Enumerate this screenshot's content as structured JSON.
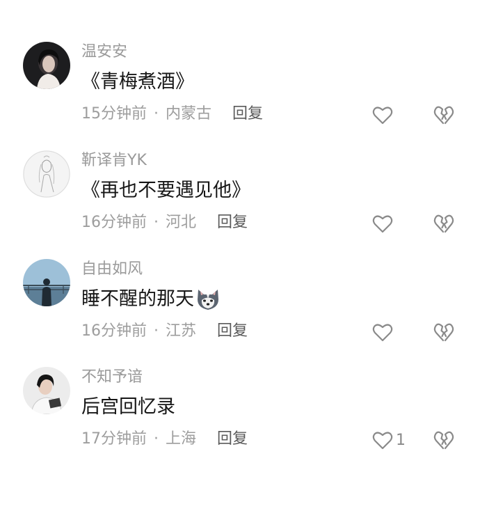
{
  "comments": [
    {
      "username": "温安安",
      "content": "《青梅煮酒》",
      "time": "15分钟前",
      "location": "内蒙古",
      "reply_label": "回复",
      "likes": "",
      "emoji": ""
    },
    {
      "username": "靳译肯YK",
      "content": "《再也不要遇见他》",
      "time": "16分钟前",
      "location": "河北",
      "reply_label": "回复",
      "likes": "",
      "emoji": ""
    },
    {
      "username": "自由如风",
      "content": "睡不醒的那天",
      "time": "16分钟前",
      "location": "江苏",
      "reply_label": "回复",
      "likes": "",
      "emoji": "husky-emoji"
    },
    {
      "username": "不知予谙",
      "content": "后宫回忆录",
      "time": "17分钟前",
      "location": "上海",
      "reply_label": "回复",
      "likes": "1",
      "emoji": ""
    }
  ],
  "separator": "·",
  "icons": {
    "like": "heart-outline-icon",
    "dislike": "broken-heart-icon"
  },
  "colors": {
    "username": "#9a9a9a",
    "content": "#161616",
    "meta": "#9d9d9d",
    "icon": "#8a8a8a"
  }
}
